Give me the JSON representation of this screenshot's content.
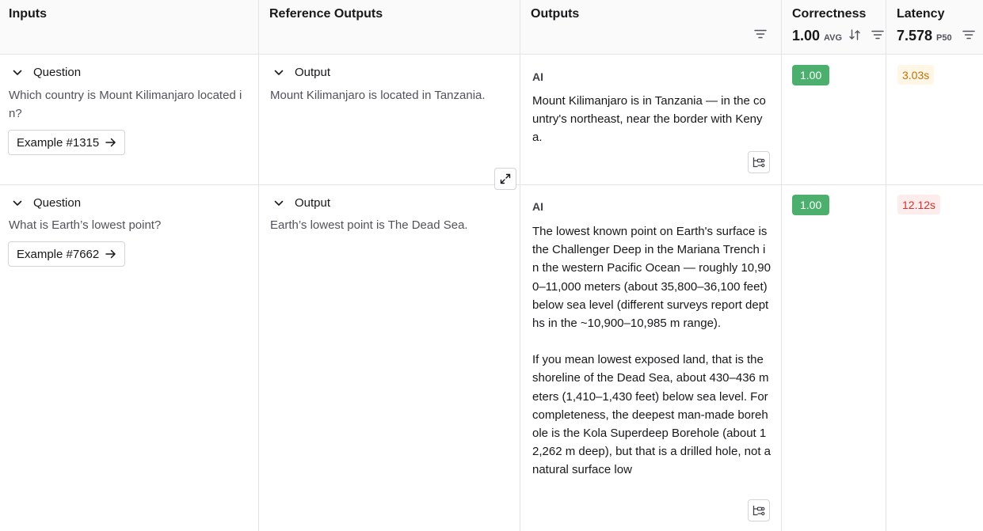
{
  "columns": {
    "inputs": "Inputs",
    "reference": "Reference Outputs",
    "outputs": "Outputs",
    "correctness": {
      "title": "Correctness",
      "value": "1.00",
      "stat": "AVG"
    },
    "latency": {
      "title": "Latency",
      "value": "7.578",
      "stat": "P50"
    }
  },
  "rows": [
    {
      "input_label": "Question",
      "input_text": "Which country is Mount Kilimanjaro located in?",
      "example_label": "Example #1315",
      "reference_label": "Output",
      "reference_text": "Mount Kilimanjaro is located in Tanzania.",
      "output_role": "AI",
      "output_paragraphs": [
        "Mount Kilimanjaro is in Tanzania — in the country's northeast, near the border with Kenya."
      ],
      "correctness": "1.00",
      "latency": "3.03s",
      "latency_level": "orange"
    },
    {
      "input_label": "Question",
      "input_text": "What is Earth’s lowest point?",
      "example_label": "Example #7662",
      "reference_label": "Output",
      "reference_text": "Earth’s lowest point is The Dead Sea.",
      "output_role": "AI",
      "output_paragraphs": [
        "The lowest known point on Earth's surface is the Challenger Deep in the Mariana Trench in the western Pacific Ocean — roughly 10,900–11,000 meters (about 35,800–36,100 feet) below sea level (different surveys report depths in the ~10,900–10,985 m range).",
        "If you mean lowest exposed land, that is the shoreline of the Dead Sea, about 430–436 meters (1,410–1,430 feet) below sea level. For completeness, the deepest man-made borehole is the Kola Superdeep Borehole (about 12,262 m deep), but that is a drilled hole, not a natural surface low"
      ],
      "correctness": "1.00",
      "latency": "12.12s",
      "latency_level": "red"
    }
  ]
}
